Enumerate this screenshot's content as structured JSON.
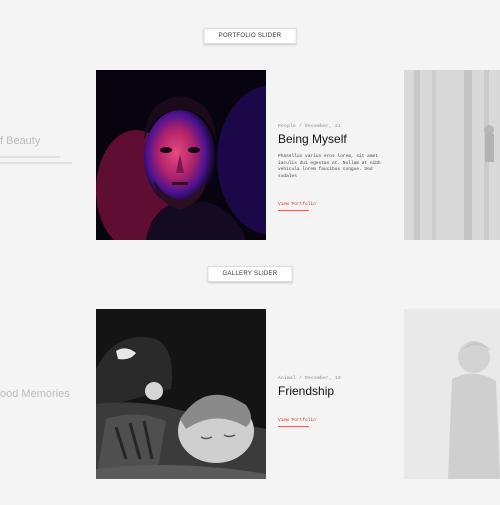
{
  "sections": [
    {
      "label": "PORTFOLIO SLIDER",
      "ghost_title": "f Beauty",
      "main": {
        "meta": "People / December, 21",
        "title": "Being Myself",
        "description": "Phasellus varius eros lorem, sit amet iaculis dui egestas at. Nullam at nibh vehicula lorem faucibus congue. Sed sodales",
        "link": "View Portfolio"
      }
    },
    {
      "label": "GALLERY SLIDER",
      "ghost_title": "ood Memories",
      "main": {
        "meta": "Animal / December, 19",
        "title": "Friendship",
        "link": "View Portfolio"
      }
    }
  ],
  "colors": {
    "background": "#f4f4f4",
    "accent": "#c0392b",
    "portrait_glow": "#e0245e",
    "portrait_shadow": "#3311a8"
  }
}
